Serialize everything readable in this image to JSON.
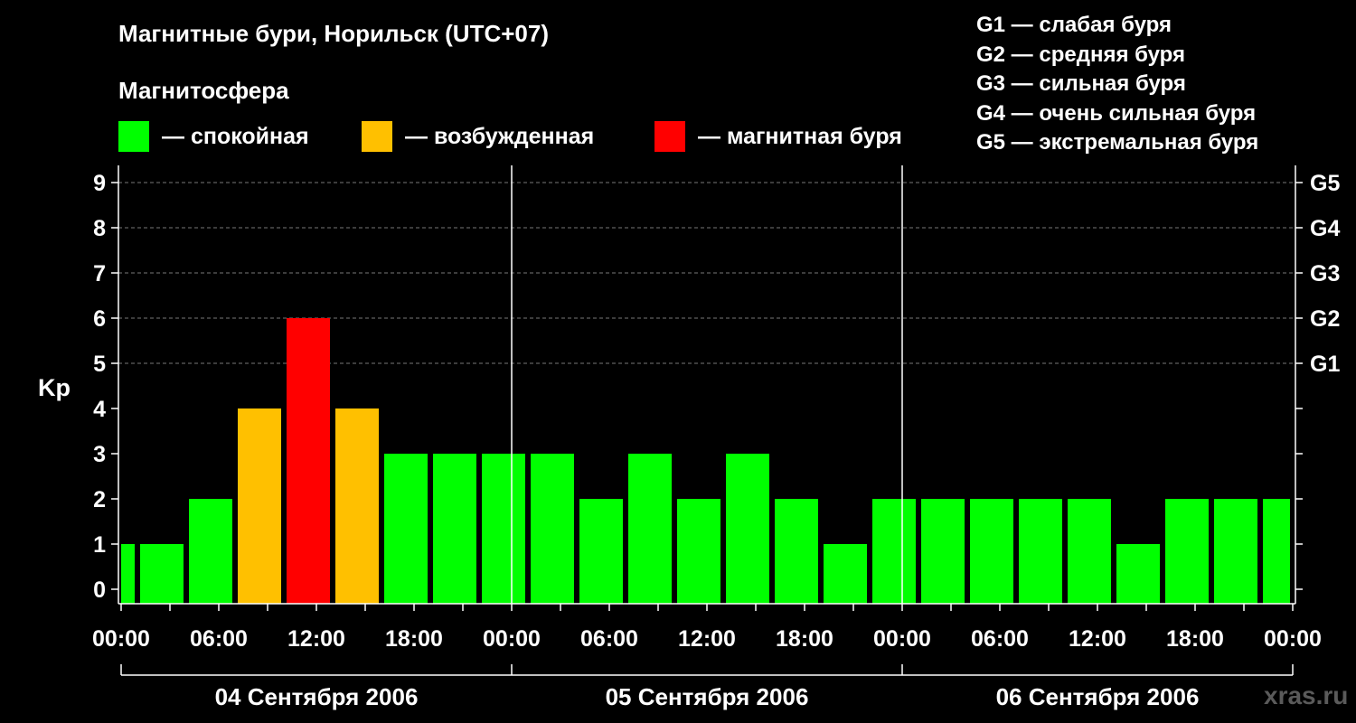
{
  "title": "Магнитные бури, Норильск (UTC+07)",
  "subtitle": "Магнитосфера",
  "legend": [
    {
      "label": "— спокойная",
      "color": "#00ff00"
    },
    {
      "label": "— возбужденная",
      "color": "#ffc000"
    },
    {
      "label": "— магнитная буря",
      "color": "#ff0000"
    }
  ],
  "g_legend": [
    "G1 — слабая буря",
    "G2 — средняя буря",
    "G3 — сильная буря",
    "G4 — очень сильная буря",
    "G5 — экстремальная буря"
  ],
  "watermark": "xras.ru",
  "chart_data": {
    "type": "bar",
    "ylabel": "Kp",
    "ylim": [
      0,
      9
    ],
    "yticks": [
      "0",
      "1",
      "2",
      "3",
      "4",
      "5",
      "6",
      "7",
      "8",
      "9"
    ],
    "right_ticks": [
      {
        "value": 5,
        "label": "G1"
      },
      {
        "value": 6,
        "label": "G2"
      },
      {
        "value": 7,
        "label": "G3"
      },
      {
        "value": 8,
        "label": "G4"
      },
      {
        "value": 9,
        "label": "G5"
      }
    ],
    "x_tick_labels": [
      "00:00",
      "06:00",
      "12:00",
      "18:00",
      "00:00",
      "06:00",
      "12:00",
      "18:00",
      "00:00",
      "06:00",
      "12:00",
      "18:00",
      "00:00"
    ],
    "days": [
      "04 Сентября 2006",
      "05 Сентября 2006",
      "06 Сентября 2006"
    ],
    "bar_interval_hours": 3,
    "bar_start_hours": [
      0,
      1,
      4,
      7,
      10,
      13,
      16,
      19,
      22,
      25,
      28,
      31,
      34,
      37,
      40,
      43,
      46,
      49,
      52,
      55,
      58,
      61,
      64,
      67,
      70
    ],
    "values": [
      1,
      1,
      2,
      4,
      6,
      4,
      3,
      3,
      3,
      3,
      2,
      3,
      2,
      3,
      2,
      1,
      2,
      2,
      2,
      2,
      2,
      1,
      2,
      2,
      2
    ],
    "color_scale": {
      "quiet": "#00ff00",
      "active": "#ffc000",
      "storm": "#ff0000"
    },
    "grid": true
  }
}
